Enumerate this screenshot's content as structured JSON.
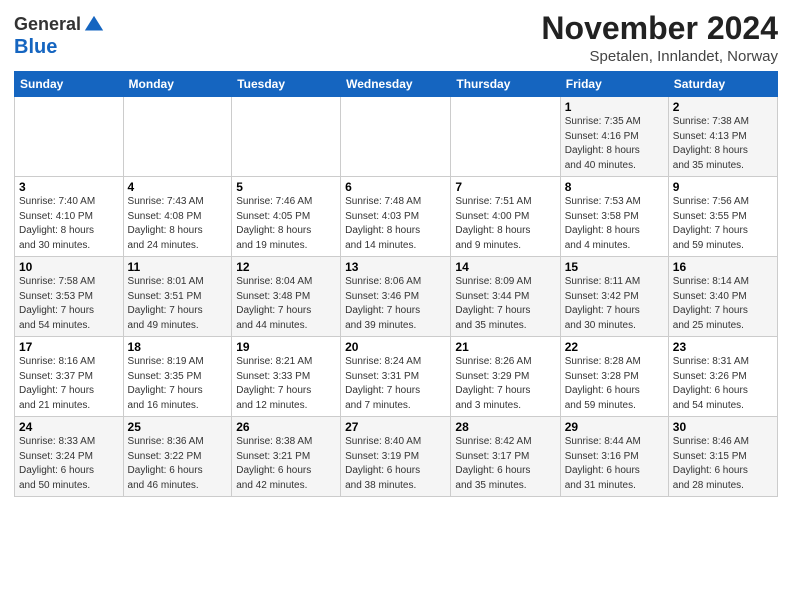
{
  "logo": {
    "general": "General",
    "blue": "Blue"
  },
  "header": {
    "title": "November 2024",
    "subtitle": "Spetalen, Innlandet, Norway"
  },
  "weekdays": [
    "Sunday",
    "Monday",
    "Tuesday",
    "Wednesday",
    "Thursday",
    "Friday",
    "Saturday"
  ],
  "weeks": [
    [
      {
        "num": "",
        "detail": ""
      },
      {
        "num": "",
        "detail": ""
      },
      {
        "num": "",
        "detail": ""
      },
      {
        "num": "",
        "detail": ""
      },
      {
        "num": "",
        "detail": ""
      },
      {
        "num": "1",
        "detail": "Sunrise: 7:35 AM\nSunset: 4:16 PM\nDaylight: 8 hours\nand 40 minutes."
      },
      {
        "num": "2",
        "detail": "Sunrise: 7:38 AM\nSunset: 4:13 PM\nDaylight: 8 hours\nand 35 minutes."
      }
    ],
    [
      {
        "num": "3",
        "detail": "Sunrise: 7:40 AM\nSunset: 4:10 PM\nDaylight: 8 hours\nand 30 minutes."
      },
      {
        "num": "4",
        "detail": "Sunrise: 7:43 AM\nSunset: 4:08 PM\nDaylight: 8 hours\nand 24 minutes."
      },
      {
        "num": "5",
        "detail": "Sunrise: 7:46 AM\nSunset: 4:05 PM\nDaylight: 8 hours\nand 19 minutes."
      },
      {
        "num": "6",
        "detail": "Sunrise: 7:48 AM\nSunset: 4:03 PM\nDaylight: 8 hours\nand 14 minutes."
      },
      {
        "num": "7",
        "detail": "Sunrise: 7:51 AM\nSunset: 4:00 PM\nDaylight: 8 hours\nand 9 minutes."
      },
      {
        "num": "8",
        "detail": "Sunrise: 7:53 AM\nSunset: 3:58 PM\nDaylight: 8 hours\nand 4 minutes."
      },
      {
        "num": "9",
        "detail": "Sunrise: 7:56 AM\nSunset: 3:55 PM\nDaylight: 7 hours\nand 59 minutes."
      }
    ],
    [
      {
        "num": "10",
        "detail": "Sunrise: 7:58 AM\nSunset: 3:53 PM\nDaylight: 7 hours\nand 54 minutes."
      },
      {
        "num": "11",
        "detail": "Sunrise: 8:01 AM\nSunset: 3:51 PM\nDaylight: 7 hours\nand 49 minutes."
      },
      {
        "num": "12",
        "detail": "Sunrise: 8:04 AM\nSunset: 3:48 PM\nDaylight: 7 hours\nand 44 minutes."
      },
      {
        "num": "13",
        "detail": "Sunrise: 8:06 AM\nSunset: 3:46 PM\nDaylight: 7 hours\nand 39 minutes."
      },
      {
        "num": "14",
        "detail": "Sunrise: 8:09 AM\nSunset: 3:44 PM\nDaylight: 7 hours\nand 35 minutes."
      },
      {
        "num": "15",
        "detail": "Sunrise: 8:11 AM\nSunset: 3:42 PM\nDaylight: 7 hours\nand 30 minutes."
      },
      {
        "num": "16",
        "detail": "Sunrise: 8:14 AM\nSunset: 3:40 PM\nDaylight: 7 hours\nand 25 minutes."
      }
    ],
    [
      {
        "num": "17",
        "detail": "Sunrise: 8:16 AM\nSunset: 3:37 PM\nDaylight: 7 hours\nand 21 minutes."
      },
      {
        "num": "18",
        "detail": "Sunrise: 8:19 AM\nSunset: 3:35 PM\nDaylight: 7 hours\nand 16 minutes."
      },
      {
        "num": "19",
        "detail": "Sunrise: 8:21 AM\nSunset: 3:33 PM\nDaylight: 7 hours\nand 12 minutes."
      },
      {
        "num": "20",
        "detail": "Sunrise: 8:24 AM\nSunset: 3:31 PM\nDaylight: 7 hours\nand 7 minutes."
      },
      {
        "num": "21",
        "detail": "Sunrise: 8:26 AM\nSunset: 3:29 PM\nDaylight: 7 hours\nand 3 minutes."
      },
      {
        "num": "22",
        "detail": "Sunrise: 8:28 AM\nSunset: 3:28 PM\nDaylight: 6 hours\nand 59 minutes."
      },
      {
        "num": "23",
        "detail": "Sunrise: 8:31 AM\nSunset: 3:26 PM\nDaylight: 6 hours\nand 54 minutes."
      }
    ],
    [
      {
        "num": "24",
        "detail": "Sunrise: 8:33 AM\nSunset: 3:24 PM\nDaylight: 6 hours\nand 50 minutes."
      },
      {
        "num": "25",
        "detail": "Sunrise: 8:36 AM\nSunset: 3:22 PM\nDaylight: 6 hours\nand 46 minutes."
      },
      {
        "num": "26",
        "detail": "Sunrise: 8:38 AM\nSunset: 3:21 PM\nDaylight: 6 hours\nand 42 minutes."
      },
      {
        "num": "27",
        "detail": "Sunrise: 8:40 AM\nSunset: 3:19 PM\nDaylight: 6 hours\nand 38 minutes."
      },
      {
        "num": "28",
        "detail": "Sunrise: 8:42 AM\nSunset: 3:17 PM\nDaylight: 6 hours\nand 35 minutes."
      },
      {
        "num": "29",
        "detail": "Sunrise: 8:44 AM\nSunset: 3:16 PM\nDaylight: 6 hours\nand 31 minutes."
      },
      {
        "num": "30",
        "detail": "Sunrise: 8:46 AM\nSunset: 3:15 PM\nDaylight: 6 hours\nand 28 minutes."
      }
    ]
  ]
}
